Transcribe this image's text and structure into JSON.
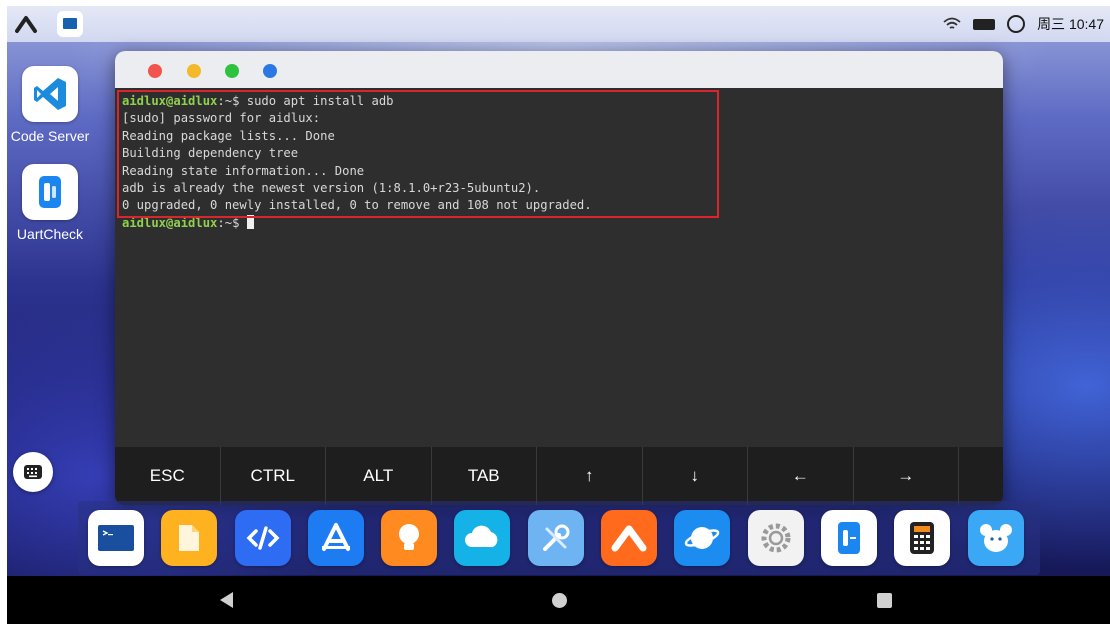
{
  "status_bar": {
    "time": "周三 10:47",
    "icons": [
      "aidlux-logo-icon",
      "terminal-app-icon",
      "wifi-icon",
      "battery-icon",
      "circle-icon"
    ]
  },
  "desktop": {
    "apps": [
      {
        "label": "Code Server",
        "icon": "vscode-icon"
      },
      {
        "label": "UartCheck",
        "icon": "uartcheck-icon"
      }
    ]
  },
  "terminal": {
    "window_controls": [
      "close-dot",
      "minimize-dot",
      "maximize-dot",
      "extra-dot"
    ],
    "window_control_colors": [
      "#f0544c",
      "#f3b92a",
      "#2fc23e",
      "#2b78e4"
    ],
    "prompt_user": "aidlux@aidlux",
    "prompt_path": ":~$ ",
    "command": "sudo apt install adb",
    "output_lines": [
      "[sudo] password for aidlux:",
      "Reading package lists... Done",
      "Building dependency tree",
      "Reading state information... Done",
      "adb is already the newest version (1:8.1.0+r23-5ubuntu2).",
      "0 upgraded, 0 newly installed, 0 to remove and 108 not upgraded."
    ],
    "highlight_color": "#d8262c",
    "keys": [
      "ESC",
      "CTRL",
      "ALT",
      "TAB",
      "↑",
      "↓",
      "←",
      "→"
    ]
  },
  "dock": {
    "apps": [
      {
        "icon": "terminal-icon",
        "bg": "#ffffff"
      },
      {
        "icon": "files-icon",
        "bg": "#ffb21f"
      },
      {
        "icon": "code-icon",
        "bg": "#2f6cf4"
      },
      {
        "icon": "appstore-icon",
        "bg": "#1e7cf2"
      },
      {
        "icon": "bulb-icon",
        "bg": "#ff8a1f"
      },
      {
        "icon": "cloud-icon",
        "bg": "#15b2e8"
      },
      {
        "icon": "tools-icon",
        "bg": "#6fb4f2"
      },
      {
        "icon": "aidlux-icon",
        "bg": "#ff6a1c"
      },
      {
        "icon": "browser-icon",
        "bg": "#1d8cf0"
      },
      {
        "icon": "settings-icon",
        "bg": "#f2f2f2"
      },
      {
        "icon": "uart-icon",
        "bg": "#ffffff"
      },
      {
        "icon": "calculator-icon",
        "bg": "#ffffff"
      },
      {
        "icon": "mascot-icon",
        "bg": "#3aa8f5"
      }
    ]
  },
  "nav_bar": {
    "buttons": [
      "back-button",
      "home-button",
      "recents-button"
    ]
  }
}
